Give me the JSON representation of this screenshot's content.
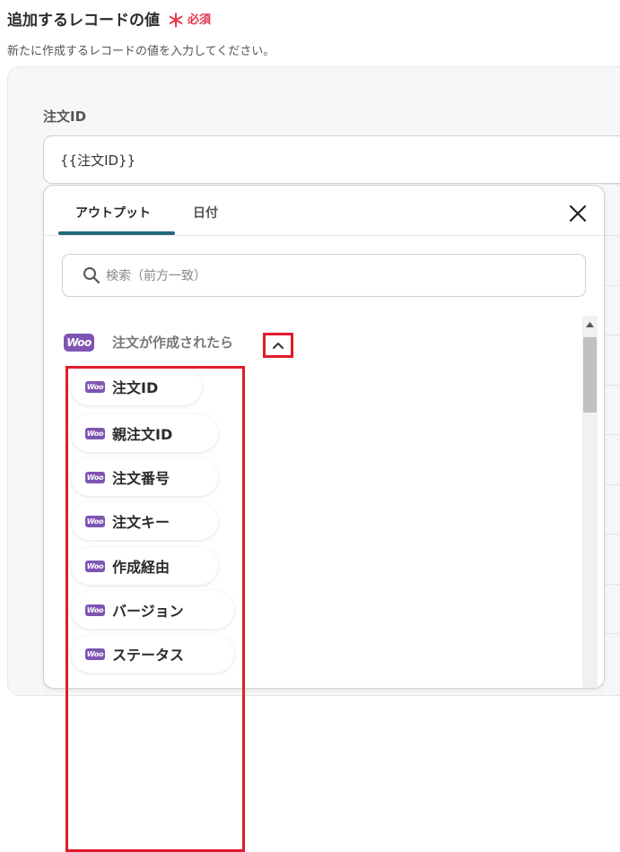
{
  "section": {
    "title": "追加するレコードの値",
    "required_mark": "＊",
    "required_label": "必須",
    "description": "新たに作成するレコードの値を入力してください。"
  },
  "field": {
    "label": "注文ID",
    "value": "{{注文ID}}"
  },
  "dropdown": {
    "tabs": [
      {
        "label": "アウトプット",
        "active": true
      },
      {
        "label": "日付",
        "active": false
      }
    ],
    "search_placeholder": "検索（前方一致）",
    "group": {
      "logo_text": "Woo",
      "label": "注文が作成されたら",
      "expanded": true
    },
    "items": [
      {
        "label": "注文ID"
      },
      {
        "label": "親注文ID"
      },
      {
        "label": "注文番号"
      },
      {
        "label": "注文キー"
      },
      {
        "label": "作成経由"
      },
      {
        "label": "バージョン"
      },
      {
        "label": "ステータス"
      }
    ],
    "item_logo_text": "Woo"
  },
  "colors": {
    "accent": "#226a7e",
    "required": "#e4344a",
    "highlight": "#e21b2c",
    "woo": "#7f54b3"
  }
}
